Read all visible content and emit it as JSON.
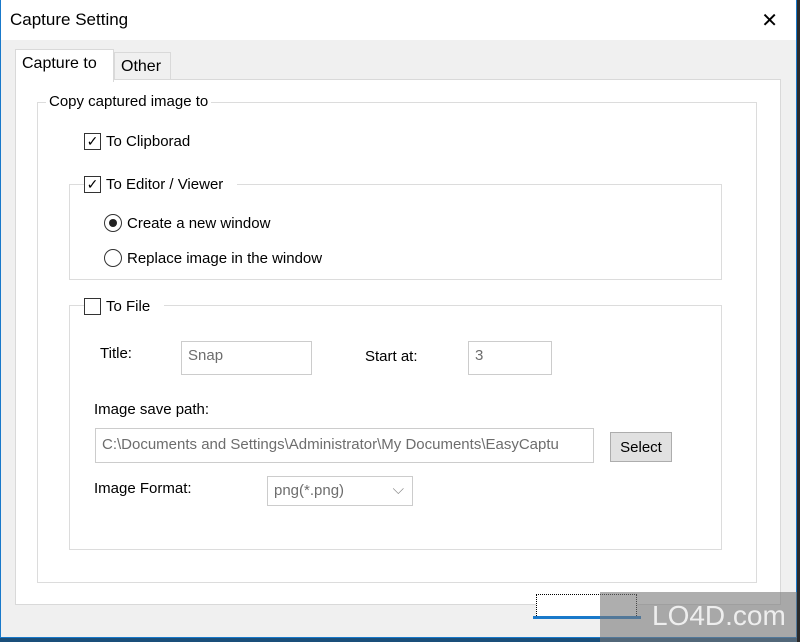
{
  "window": {
    "title": "Capture Setting",
    "close": "✕"
  },
  "tabs": [
    {
      "label": "Capture to",
      "active": true
    },
    {
      "label": "Other",
      "active": false
    }
  ],
  "group": {
    "legend": "Copy captured image to"
  },
  "clipboard": {
    "label": "To Clipborad",
    "checked": true
  },
  "editor": {
    "label": "To Editor / Viewer",
    "checked": true,
    "options": [
      {
        "label": "Create a new window",
        "selected": true
      },
      {
        "label": "Replace image in the window",
        "selected": false
      }
    ]
  },
  "file": {
    "label": "To File",
    "checked": false,
    "title_label": "Title:",
    "title_value": "Snap",
    "start_label": "Start at:",
    "start_value": "3",
    "path_label": "Image save path:",
    "path_value": "C:\\Documents and Settings\\Administrator\\My Documents\\EasyCaptu",
    "select_button": "Select",
    "format_label": "Image Format:",
    "format_value": "png(*.png)"
  },
  "watermark": "LO4D.com"
}
